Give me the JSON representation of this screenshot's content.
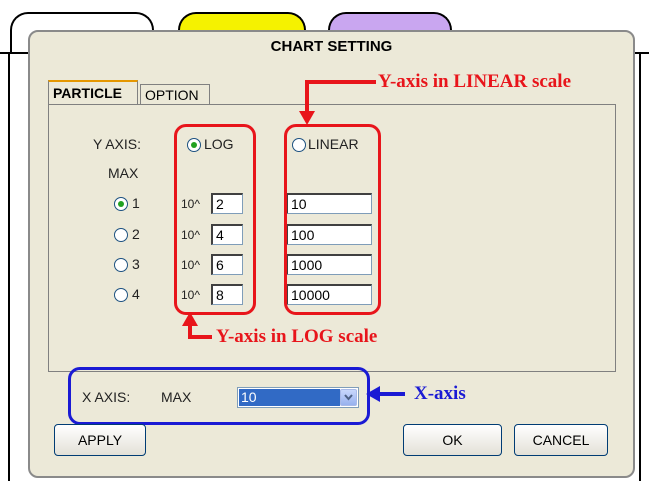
{
  "dialog": {
    "title": "CHART SETTING"
  },
  "tabs": [
    {
      "label": "PARTICLE",
      "selected": true
    },
    {
      "label": "OPTION",
      "selected": false
    }
  ],
  "y_axis": {
    "label": "Y AXIS:",
    "max_label": "MAX",
    "scale_options": [
      {
        "label": "LOG",
        "selected": true
      },
      {
        "label": "LINEAR",
        "selected": false
      }
    ],
    "rows": [
      {
        "index": "1",
        "selected": true,
        "prefix": "10^",
        "log_exp": "2",
        "linear": "10"
      },
      {
        "index": "2",
        "selected": false,
        "prefix": "10^",
        "log_exp": "4",
        "linear": "100"
      },
      {
        "index": "3",
        "selected": false,
        "prefix": "10^",
        "log_exp": "6",
        "linear": "1000"
      },
      {
        "index": "4",
        "selected": false,
        "prefix": "10^",
        "log_exp": "8",
        "linear": "10000"
      }
    ]
  },
  "x_axis": {
    "label": "X AXIS:",
    "max_label": "MAX",
    "selected_value": "10"
  },
  "buttons": {
    "apply": "APPLY",
    "ok": "OK",
    "cancel": "CANCEL"
  },
  "annotations": {
    "linear": "Y-axis in LINEAR scale",
    "log": "Y-axis in LOG scale",
    "x_axis": "X-axis"
  },
  "colors": {
    "annotation_red": "#e8151b",
    "annotation_blue": "#1a1ad4",
    "selection_blue": "#316ac5",
    "radio_green": "#21a121"
  }
}
